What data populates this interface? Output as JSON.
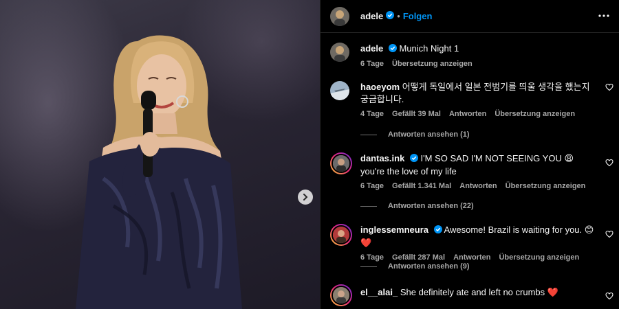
{
  "header": {
    "username": "adele",
    "separator": "•",
    "follow_label": "Folgen"
  },
  "caption": {
    "username": "adele",
    "text": "Munich Night 1",
    "time": "6 Tage",
    "translate": "Übersetzung anzeigen"
  },
  "comments": [
    {
      "username": "haoeyom",
      "text": "어떻게 독일에서 일본 전범기를 띄울 생각을 했는지 궁금합니다.",
      "time": "4 Tage",
      "likes": "Gefällt 39 Mal",
      "reply": "Antworten",
      "translate": "Übersetzung anzeigen",
      "view_replies": "Antworten ansehen (1)"
    },
    {
      "username": "dantas.ink",
      "text": "I'M SO SAD I'M NOT SEEING YOU 😩 you're the love of my life",
      "time": "6 Tage",
      "likes": "Gefällt 1.341 Mal",
      "reply": "Antworten",
      "translate": "Übersetzung anzeigen",
      "view_replies": "Antworten ansehen (22)"
    },
    {
      "username": "inglessemneura",
      "text": "Awesome! Brazil is waiting for you. 😊❤️",
      "time": "6 Tage",
      "likes": "Gefällt 287 Mal",
      "reply": "Antworten",
      "translate": "Übersetzung anzeigen",
      "view_replies": "Antworten ansehen (9)"
    },
    {
      "username": "el__alai_",
      "text": "She definitely ate and left no crumbs ❤️"
    }
  ],
  "icons": {
    "verified": "verified-badge-icon",
    "more": "more-options-icon",
    "heart": "heart-icon",
    "next": "chevron-right-icon"
  },
  "colors": {
    "accent": "#0095f6",
    "background": "#000000",
    "secondary_text": "#a8a8a8"
  }
}
